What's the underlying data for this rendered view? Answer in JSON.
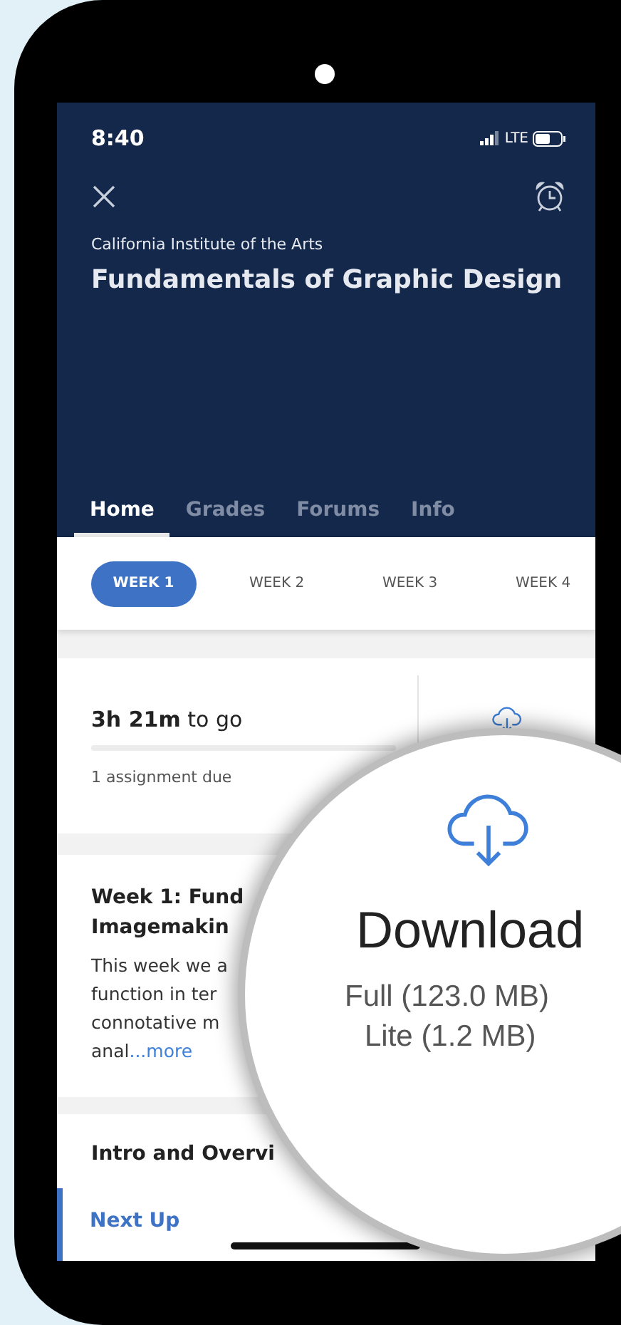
{
  "status_bar": {
    "time": "8:40",
    "network": "LTE"
  },
  "course": {
    "institution": "California Institute of the Arts",
    "title": "Fundamentals of Graphic Design"
  },
  "tabs": [
    {
      "label": "Home",
      "selected": true
    },
    {
      "label": "Grades",
      "selected": false
    },
    {
      "label": "Forums",
      "selected": false
    },
    {
      "label": "Info",
      "selected": false
    }
  ],
  "weeks": [
    {
      "label": "WEEK 1",
      "selected": true
    },
    {
      "label": "WEEK 2",
      "selected": false
    },
    {
      "label": "WEEK 3",
      "selected": false
    },
    {
      "label": "WEEK 4",
      "selected": false
    }
  ],
  "deadline": {
    "countdown": "**3h 21m** to go",
    "assignments": "1 assignment due"
  },
  "week_card": {
    "title_lines": [
      "Week 1: Fund",
      "Imagemakin"
    ],
    "description_lines": [
      "This week we a",
      "function in ter",
      "connotative m",
      "anal"
    ],
    "more_link": "...more"
  },
  "section": {
    "title": "Intro and Overvi",
    "next_up": "Next Up"
  },
  "magnifier": {
    "title": "Download",
    "options": [
      "Full (123.0 MB)",
      "Lite (1.2 MB)"
    ]
  }
}
